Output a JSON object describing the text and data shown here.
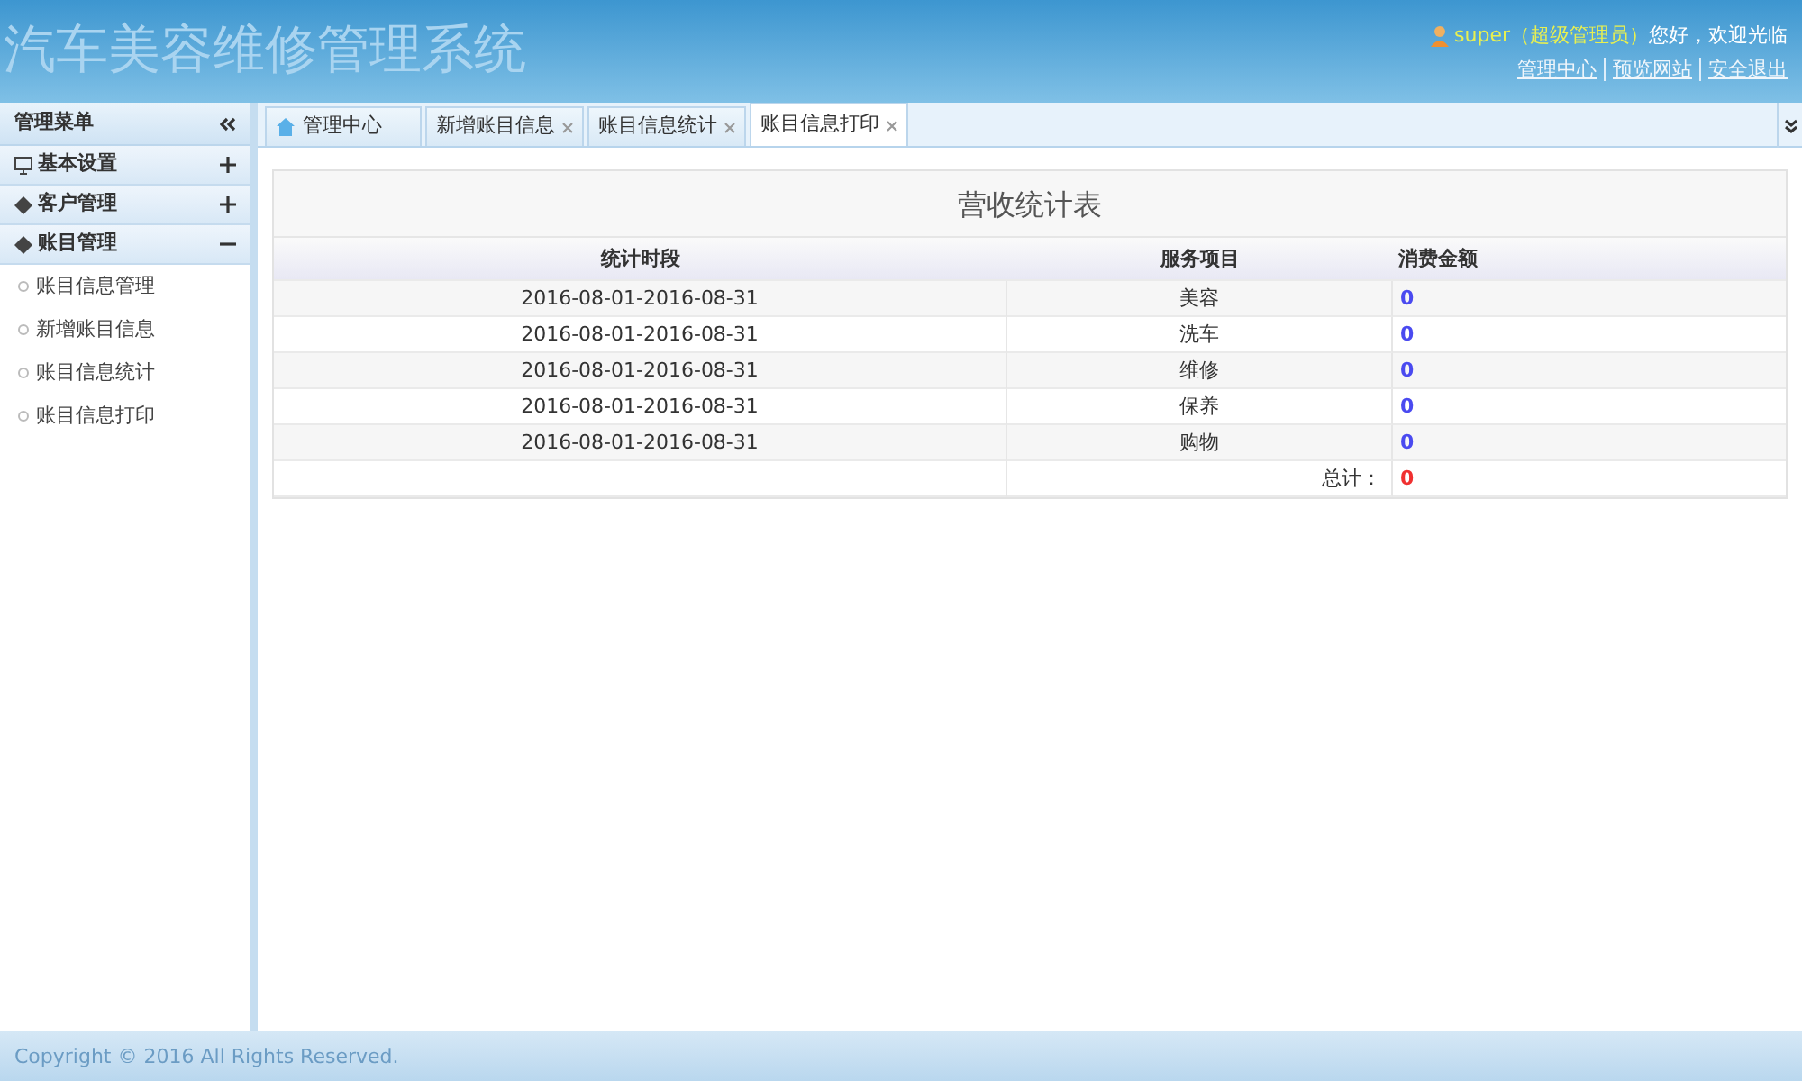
{
  "header": {
    "title": "汽车美容维修管理系统",
    "user": "super",
    "role": "（超级管理员）",
    "greeting": "您好，欢迎光临",
    "links": [
      "管理中心",
      "预览网站",
      "安全退出"
    ]
  },
  "sidebar": {
    "title": "管理菜单",
    "groups": [
      {
        "label": "基本设置",
        "expanded": false
      },
      {
        "label": "客户管理",
        "expanded": false
      },
      {
        "label": "账目管理",
        "expanded": true,
        "children": [
          {
            "label": "账目信息管理"
          },
          {
            "label": "新增账目信息"
          },
          {
            "label": "账目信息统计"
          },
          {
            "label": "账目信息打印"
          }
        ]
      }
    ]
  },
  "tabs": [
    {
      "label": "管理中心",
      "selected": false
    },
    {
      "label": "新增账目信息",
      "selected": false
    },
    {
      "label": "账目信息统计",
      "selected": false
    },
    {
      "label": "账目信息打印",
      "selected": true
    }
  ],
  "report": {
    "title": "营收统计表",
    "columns": [
      "统计时段",
      "服务项目",
      "消费金额"
    ],
    "rows": [
      {
        "period": "2016-08-01-2016-08-31",
        "service": "美容",
        "amount": "0"
      },
      {
        "period": "2016-08-01-2016-08-31",
        "service": "洗车",
        "amount": "0"
      },
      {
        "period": "2016-08-01-2016-08-31",
        "service": "维修",
        "amount": "0"
      },
      {
        "period": "2016-08-01-2016-08-31",
        "service": "保养",
        "amount": "0"
      },
      {
        "period": "2016-08-01-2016-08-31",
        "service": "购物",
        "amount": "0"
      }
    ],
    "total_label": "总计：",
    "total": "0"
  },
  "footer": "Copyright © 2016 All Rights Reserved."
}
